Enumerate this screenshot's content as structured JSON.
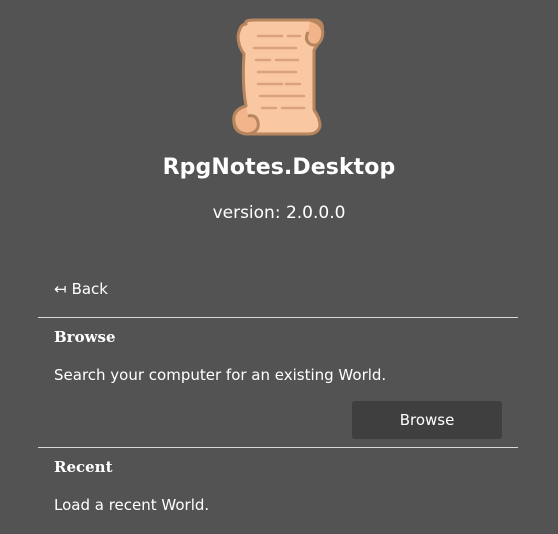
{
  "app": {
    "title": "RpgNotes.Desktop",
    "version_text": "version: 2.0.0.0",
    "logo_icon": "scroll-icon"
  },
  "nav": {
    "back_arrow": "↤",
    "back_label": "Back"
  },
  "sections": {
    "browse": {
      "heading": "Browse",
      "description": "Search your computer for an existing World.",
      "button_label": "Browse"
    },
    "recent": {
      "heading": "Recent",
      "description": "Load a recent World."
    }
  },
  "colors": {
    "background": "#535353",
    "button": "#3f3f3f",
    "divider": "#d8d8d8",
    "scroll_fill": "#f9c8a3",
    "scroll_outline": "#b7865f"
  }
}
